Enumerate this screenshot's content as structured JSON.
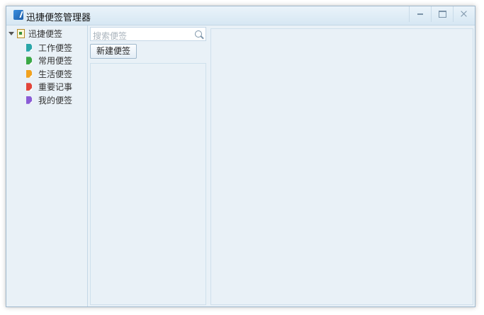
{
  "window": {
    "title": "迅捷便签管理器"
  },
  "tree": {
    "root_label": "迅捷便签",
    "items": [
      {
        "label": "工作便签",
        "color": "#2aa6a8"
      },
      {
        "label": "常用便签",
        "color": "#3aa846"
      },
      {
        "label": "生活便签",
        "color": "#f2a21f"
      },
      {
        "label": "重要记事",
        "color": "#e2453a"
      },
      {
        "label": "我的便签",
        "color": "#8a5cd6"
      }
    ]
  },
  "search": {
    "placeholder": "搜索便签"
  },
  "toolbar": {
    "new_note_label": "新建便签"
  }
}
